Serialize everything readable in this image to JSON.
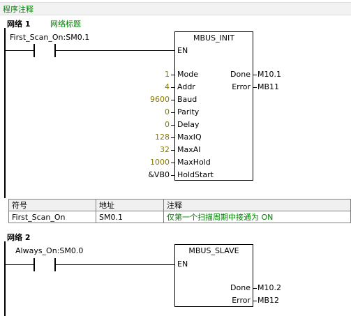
{
  "header": {
    "title": "程序注释"
  },
  "network1": {
    "label": "网络 1",
    "title": "网络标题",
    "contact_label": "First_Scan_On:SM0.1",
    "block": {
      "name": "MBUS_INIT",
      "en": "EN",
      "inputs": [
        {
          "value": "1",
          "pin": "Mode"
        },
        {
          "value": "4",
          "pin": "Addr"
        },
        {
          "value": "9600",
          "pin": "Baud"
        },
        {
          "value": "0",
          "pin": "Parity"
        },
        {
          "value": "0",
          "pin": "Delay"
        },
        {
          "value": "128",
          "pin": "MaxIQ"
        },
        {
          "value": "32",
          "pin": "MaxAI"
        },
        {
          "value": "1000",
          "pin": "MaxHold"
        },
        {
          "value": "&VB0",
          "pin": "HoldStart"
        }
      ],
      "outputs": [
        {
          "pin": "Done",
          "value": "M10.1"
        },
        {
          "pin": "Error",
          "value": "MB11"
        }
      ]
    }
  },
  "symbol_table": {
    "headers": [
      "符号",
      "地址",
      "注释"
    ],
    "rows": [
      [
        "First_Scan_On",
        "SM0.1",
        "仅第一个扫描周期中接通为 ON"
      ]
    ]
  },
  "network2": {
    "label": "网络 2",
    "contact_label": "Always_On:SM0.0",
    "block": {
      "name": "MBUS_SLAVE",
      "en": "EN",
      "outputs": [
        {
          "pin": "Done",
          "value": "M10.2"
        },
        {
          "pin": "Error",
          "value": "MB12"
        }
      ]
    }
  }
}
